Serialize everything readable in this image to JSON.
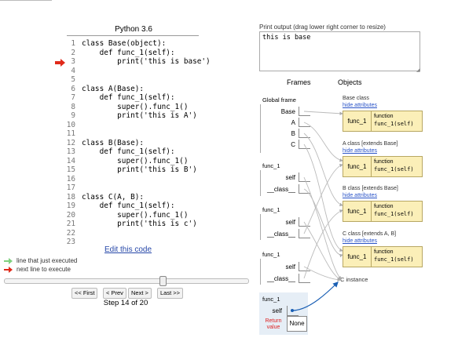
{
  "language": "Python 3.6",
  "code_lines": [
    {
      "n": "1",
      "text": "class Base(object):"
    },
    {
      "n": "2",
      "text": "    def func_1(self):"
    },
    {
      "n": "3",
      "text": "        print('this is base')"
    },
    {
      "n": "4",
      "text": ""
    },
    {
      "n": "5",
      "text": ""
    },
    {
      "n": "6",
      "text": "class A(Base):"
    },
    {
      "n": "7",
      "text": "    def func_1(self):"
    },
    {
      "n": "8",
      "text": "        super().func_1()"
    },
    {
      "n": "9",
      "text": "        print('this is A')"
    },
    {
      "n": "10",
      "text": ""
    },
    {
      "n": "11",
      "text": ""
    },
    {
      "n": "12",
      "text": "class B(Base):"
    },
    {
      "n": "13",
      "text": "    def func_1(self):"
    },
    {
      "n": "14",
      "text": "        super().func_1()"
    },
    {
      "n": "15",
      "text": "        print('this is B')"
    },
    {
      "n": "16",
      "text": ""
    },
    {
      "n": "17",
      "text": ""
    },
    {
      "n": "18",
      "text": "class C(A, B):"
    },
    {
      "n": "19",
      "text": "    def func_1(self):"
    },
    {
      "n": "20",
      "text": "        super().func_1()"
    },
    {
      "n": "21",
      "text": "        print('this is c')"
    },
    {
      "n": "22",
      "text": ""
    },
    {
      "n": "23",
      "text": ""
    }
  ],
  "current_line": 3,
  "edit_link": "Edit this code",
  "legend": {
    "just_executed": "line that just executed",
    "next_line": "next line to execute",
    "just_executed_color": "#7fd17f",
    "next_line_color": "#e02a1a"
  },
  "navigation": {
    "first": "<< First",
    "prev": "< Prev",
    "next": "Next >",
    "last": "Last >>",
    "step_text": "Step 14 of 20",
    "progress": 0.65
  },
  "print_output": {
    "caption": "Print output (drag lower right corner to resize)",
    "text": "this is base"
  },
  "headers": {
    "frames": "Frames",
    "objects": "Objects"
  },
  "global_frame": {
    "title": "Global frame",
    "vars": [
      "Base",
      "A",
      "B",
      "C"
    ]
  },
  "frames": [
    {
      "title": "func_1",
      "vars": [
        "self",
        "__class__"
      ]
    },
    {
      "title": "func_1",
      "vars": [
        "self",
        "__class__"
      ]
    },
    {
      "title": "func_1",
      "vars": [
        "self",
        "__class__"
      ]
    }
  ],
  "active_frame": {
    "title": "func_1",
    "var": "self",
    "return_label": "Return value",
    "return_value": "None",
    "color": "#e6eef6"
  },
  "classes": [
    {
      "label": "Base class",
      "hide": "hide attributes",
      "key": "func_1",
      "fn_type": "function",
      "fn_sig": "func_1(self)"
    },
    {
      "label": "A class [extends Base]",
      "hide": "hide attributes",
      "key": "func_1",
      "fn_type": "function",
      "fn_sig": "func_1(self)"
    },
    {
      "label": "B class [extends Base]",
      "hide": "hide attributes",
      "key": "func_1",
      "fn_type": "function",
      "fn_sig": "func_1(self)"
    },
    {
      "label": "C class [extends A, B]",
      "hide": "hide attributes",
      "key": "func_1",
      "fn_type": "function",
      "fn_sig": "func_1(self)"
    }
  ],
  "instance_label": "C instance",
  "colors": {
    "object_fill": "#fbefb8",
    "link": "#2647a8",
    "pointer": "#1a5fb4"
  }
}
